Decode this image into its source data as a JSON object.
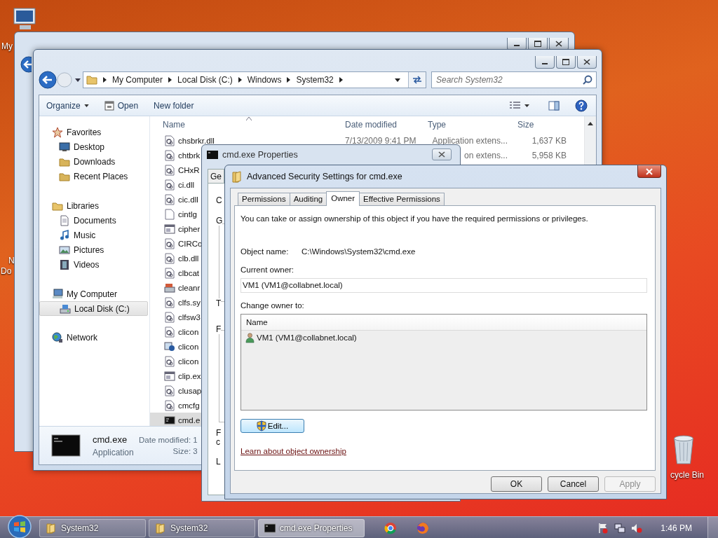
{
  "desktop": {
    "computer_label": "My",
    "documents_label": [
      "N",
      "Do"
    ],
    "recycle_bin_label": "cycle Bin"
  },
  "explorer": {
    "breadcrumb": [
      "My Computer",
      "Local Disk (C:)",
      "Windows",
      "System32"
    ],
    "search_placeholder": "Search System32",
    "toolbar": [
      {
        "label": "Organize",
        "kind": "menu"
      },
      {
        "label": "Open",
        "kind": "open"
      },
      {
        "label": "New folder",
        "kind": "plain"
      }
    ],
    "nav": [
      {
        "label": "Favorites",
        "kind": "star",
        "selected": false,
        "children": [
          {
            "label": "Desktop",
            "kind": "desktop",
            "selected": false
          },
          {
            "label": "Downloads",
            "kind": "downloads",
            "selected": false
          },
          {
            "label": "Recent Places",
            "kind": "recent",
            "selected": false
          }
        ]
      },
      {
        "label": "Libraries",
        "kind": "libraries",
        "selected": false,
        "children": [
          {
            "label": "Documents",
            "kind": "documents",
            "selected": false
          },
          {
            "label": "Music",
            "kind": "music",
            "selected": false
          },
          {
            "label": "Pictures",
            "kind": "pictures",
            "selected": false
          },
          {
            "label": "Videos",
            "kind": "videos",
            "selected": false
          }
        ]
      },
      {
        "label": "My Computer",
        "kind": "computer",
        "selected": false,
        "children": [
          {
            "label": "Local Disk (C:)",
            "kind": "drive",
            "selected": true
          }
        ]
      },
      {
        "label": "Network",
        "kind": "network",
        "selected": false
      }
    ],
    "columns": [
      "Name",
      "Date modified",
      "Type",
      "Size"
    ],
    "files": [
      {
        "name": "chsbrkr.dll",
        "date": "7/13/2009 9:41 PM",
        "type": "Application extens...",
        "size": "1,637 KB",
        "kind": "dll",
        "selected": false
      },
      {
        "name": "chtbrk",
        "type": "on extens...",
        "size": "5,958 KB",
        "kind": "dll",
        "selected": false
      },
      {
        "name": "CHxR",
        "kind": "dll",
        "selected": false
      },
      {
        "name": "ci.dll",
        "kind": "dll",
        "selected": false
      },
      {
        "name": "cic.dll",
        "kind": "dll",
        "selected": false
      },
      {
        "name": "cintlg",
        "kind": "blank",
        "selected": false
      },
      {
        "name": "cipher",
        "kind": "exe",
        "selected": false
      },
      {
        "name": "CIRCo",
        "kind": "dll",
        "selected": false
      },
      {
        "name": "clb.dll",
        "kind": "dll",
        "selected": false
      },
      {
        "name": "clbcat",
        "kind": "dll",
        "selected": false
      },
      {
        "name": "cleanr",
        "kind": "tool",
        "selected": false
      },
      {
        "name": "clfs.sy",
        "kind": "dll",
        "selected": false
      },
      {
        "name": "clfsw3",
        "kind": "dll",
        "selected": false
      },
      {
        "name": "clicon",
        "kind": "dll",
        "selected": false
      },
      {
        "name": "clicon",
        "kind": "admin",
        "selected": false
      },
      {
        "name": "clicon",
        "kind": "dll",
        "selected": false
      },
      {
        "name": "clip.ex",
        "kind": "exe",
        "selected": false
      },
      {
        "name": "clusap",
        "kind": "dll",
        "selected": false
      },
      {
        "name": "cmcfg",
        "kind": "dll",
        "selected": false
      },
      {
        "name": "cmd.e",
        "kind": "cmd",
        "selected": true
      }
    ],
    "details": {
      "name": "cmd.exe",
      "type": "Application",
      "date_label": "Date modified: 1",
      "size_label": "Size: 3"
    }
  },
  "properties": {
    "title": "cmd.exe Properties",
    "tab": "Ge",
    "fragments": [
      "C",
      "G",
      "T",
      "F",
      "F",
      "c",
      "L"
    ]
  },
  "security": {
    "title": "Advanced Security Settings for cmd.exe",
    "tabs": [
      {
        "label": "Permissions",
        "selected": false
      },
      {
        "label": "Auditing",
        "selected": false
      },
      {
        "label": "Owner",
        "selected": true
      },
      {
        "label": "Effective Permissions",
        "selected": false
      }
    ],
    "intro": "You can take or assign ownership of this object if you have the required permissions or privileges.",
    "object_name_label": "Object name:",
    "object_name": "C:\\Windows\\System32\\cmd.exe",
    "current_owner_label": "Current owner:",
    "current_owner": "VM1 (VM1@collabnet.local)",
    "change_owner_label": "Change owner to:",
    "list_header": "Name",
    "owners": [
      {
        "name": "VM1 (VM1@collabnet.local)",
        "selected": false
      }
    ],
    "edit_button": "Edit...",
    "link": "Learn about object ownership",
    "buttons": [
      {
        "label": "OK",
        "disabled": false
      },
      {
        "label": "Cancel",
        "disabled": false
      },
      {
        "label": "Apply",
        "disabled": true
      }
    ]
  },
  "taskbar": {
    "items": [
      {
        "label": "System32",
        "kind": "folder",
        "selected": false
      },
      {
        "label": "System32",
        "kind": "folder",
        "selected": false
      },
      {
        "label": "cmd.exe Properties",
        "kind": "console",
        "selected": true
      }
    ],
    "clock": "1:46 PM"
  }
}
